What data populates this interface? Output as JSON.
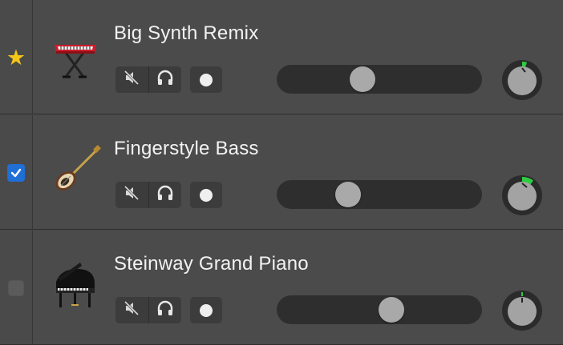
{
  "tracks": [
    {
      "name": "Big Synth Remix",
      "instrument_icon": "keyboard-synth-icon",
      "gutter_indicator": "star",
      "volume": 0.42,
      "pan": 0.1,
      "mute_icon": "speaker-muted-icon",
      "solo_icon": "headphones-icon",
      "record_icon": "record-dot-icon"
    },
    {
      "name": "Fingerstyle Bass",
      "instrument_icon": "bass-guitar-icon",
      "gutter_indicator": "checked",
      "volume": 0.35,
      "pan": 0.2,
      "mute_icon": "speaker-muted-icon",
      "solo_icon": "headphones-icon",
      "record_icon": "record-dot-icon"
    },
    {
      "name": "Steinway Grand Piano",
      "instrument_icon": "grand-piano-icon",
      "gutter_indicator": "unchecked",
      "volume": 0.56,
      "pan": 0.0,
      "mute_icon": "speaker-muted-icon",
      "solo_icon": "headphones-icon",
      "record_icon": "record-dot-icon"
    }
  ],
  "colors": {
    "background": "#4b4b4b",
    "star": "#f5c518",
    "checkbox": "#1f6fd6",
    "knob_indicator": "#2ecc40",
    "slider_track": "#2e2e2e",
    "slider_thumb": "#a9a9a9"
  }
}
